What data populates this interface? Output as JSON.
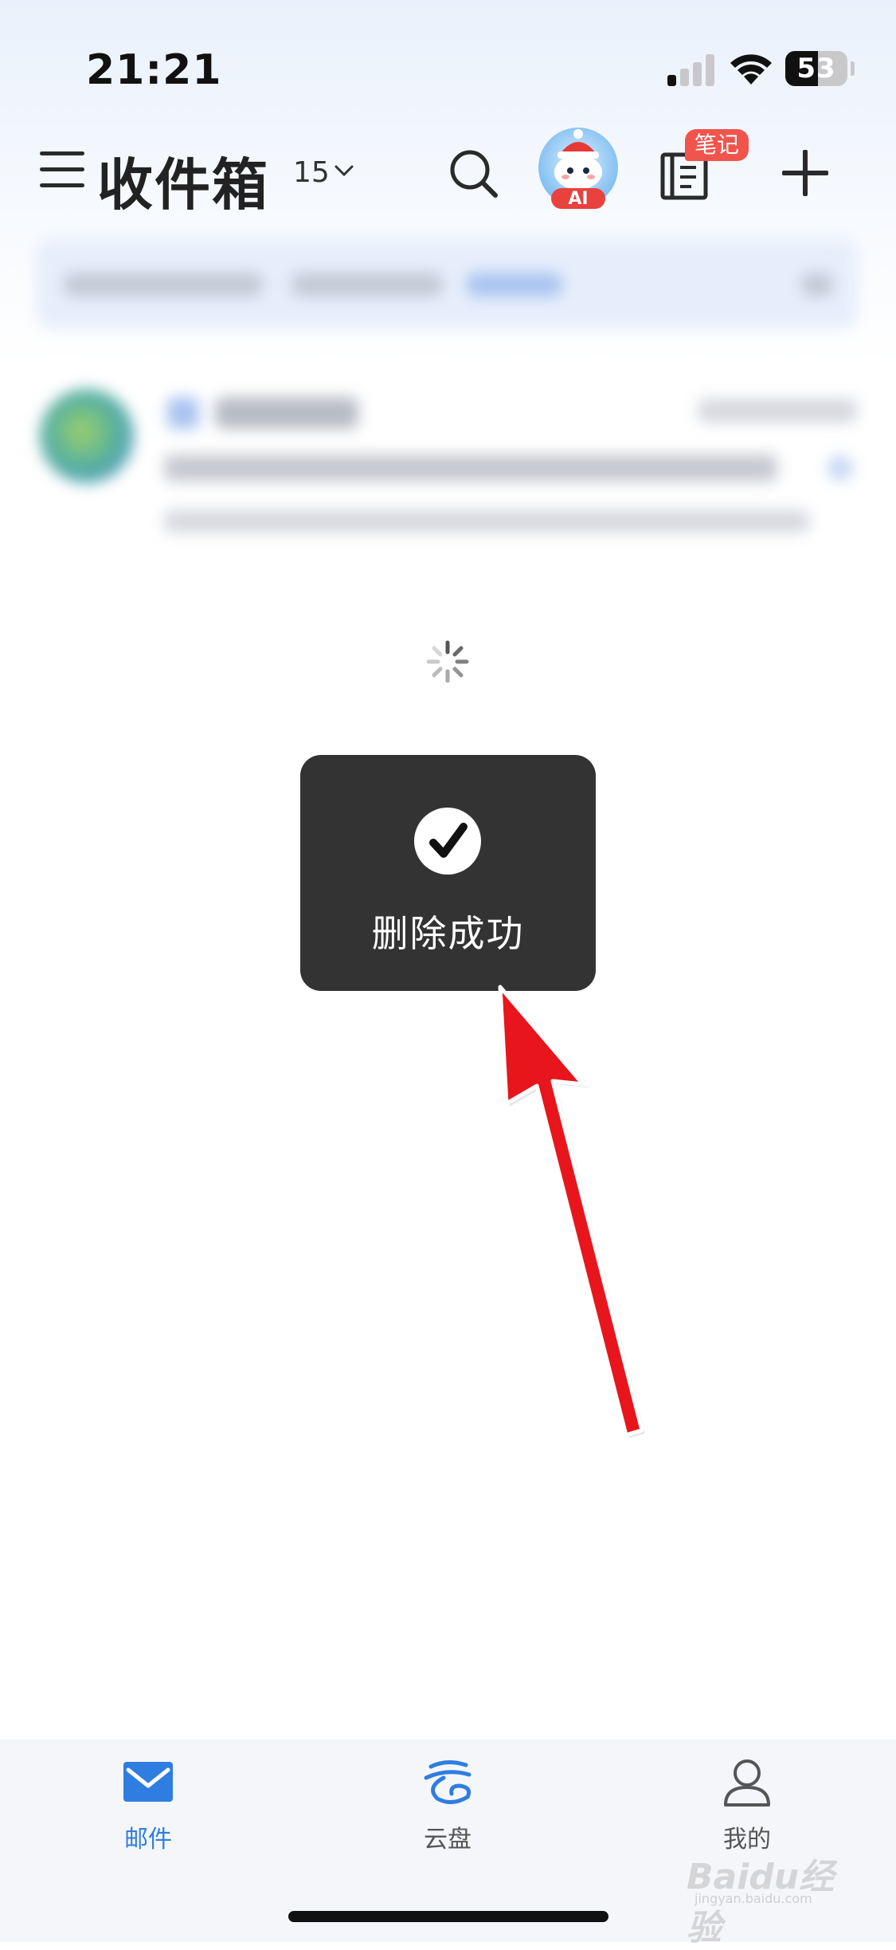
{
  "status_bar": {
    "time": "21:21",
    "battery_percent": "53",
    "signal_bars_active": 1,
    "signal_bars_total": 4
  },
  "header": {
    "title": "收件箱",
    "count": "15",
    "notes_badge": "笔记",
    "ai_label": "AI"
  },
  "toast": {
    "message": "删除成功",
    "icon": "check-circle-icon"
  },
  "tabbar": {
    "tabs": [
      {
        "label": "邮件",
        "icon": "mail-icon",
        "active": true
      },
      {
        "label": "云盘",
        "icon": "cloud-drive-icon",
        "active": false
      },
      {
        "label": "我的",
        "icon": "profile-icon",
        "active": false
      }
    ]
  },
  "watermark": {
    "text": "Baidu经验",
    "sub": "jingyan.baidu.com"
  },
  "colors": {
    "accent": "#2f7de0",
    "toast_bg": "#333333",
    "annotation_arrow": "#e8151c",
    "badge": "#f0544c"
  }
}
